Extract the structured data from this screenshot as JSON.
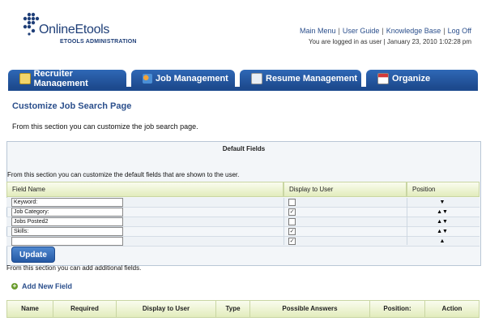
{
  "logo": {
    "name": "OnlineEtools",
    "subtitle": "ETOOLS ADMINISTRATION"
  },
  "topnav": {
    "main_menu": "Main Menu",
    "user_guide": "User Guide",
    "knowledge_base": "Knowledge Base",
    "log_off": "Log Off",
    "separator": "|"
  },
  "login_info": "You are logged in as user | January 23, 2010 1:02:28 pm",
  "tabs": [
    {
      "label": "Recruiter Management",
      "icon": "notepad-icon"
    },
    {
      "label": "Job Management",
      "icon": "people-icon"
    },
    {
      "label": "Resume Management",
      "icon": "resume-icon"
    },
    {
      "label": "Organize",
      "icon": "calendar-icon"
    }
  ],
  "page": {
    "title": "Customize Job Search Page",
    "intro": "From this section you can customize the job search page."
  },
  "default_fields": {
    "title": "Default Fields",
    "description": "From this section you can customize the default fields that are shown to the user.",
    "columns": {
      "field_name": "Field Name",
      "display": "Display to User",
      "position": "Position"
    },
    "rows": [
      {
        "name": "Keyword:",
        "checked": false,
        "arrows": "▼"
      },
      {
        "name": "Job Category:",
        "checked": true,
        "arrows": "▲▼"
      },
      {
        "name": "Jobs Posted2",
        "checked": false,
        "arrows": "▲▼"
      },
      {
        "name": "Skills:",
        "checked": true,
        "arrows": "▲▼"
      },
      {
        "name": "",
        "checked": true,
        "arrows": "▲"
      }
    ],
    "update_label": "Update"
  },
  "additional": {
    "description": "From this section you can add additional fields.",
    "add_label": "Add New Field",
    "columns": [
      "Name",
      "Required",
      "Display to User",
      "Type",
      "Possible Answers",
      "Position:",
      "Action"
    ]
  },
  "colors": {
    "brand_blue": "#1d4a8e",
    "link_blue": "#2b4f8c",
    "header_green": "#e2ecbc"
  }
}
